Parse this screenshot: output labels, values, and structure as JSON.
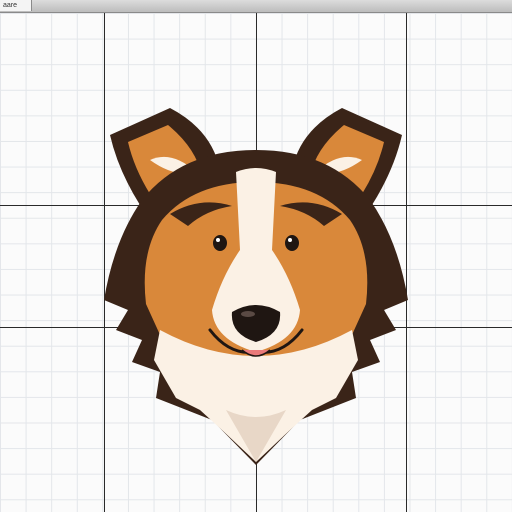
{
  "toolbar": {
    "tab_label": "aare"
  },
  "canvas": {
    "grid": true
  },
  "artwork": {
    "subject_icon": "collie-dog-head-icon",
    "colors": {
      "dark_brown": "#3a2418",
      "orange": "#d9883a",
      "cream": "#fbf1e5",
      "nose": "#1f1612",
      "grid_major": "#2a2a2a",
      "grid_minor": "#e3e6ea"
    }
  }
}
